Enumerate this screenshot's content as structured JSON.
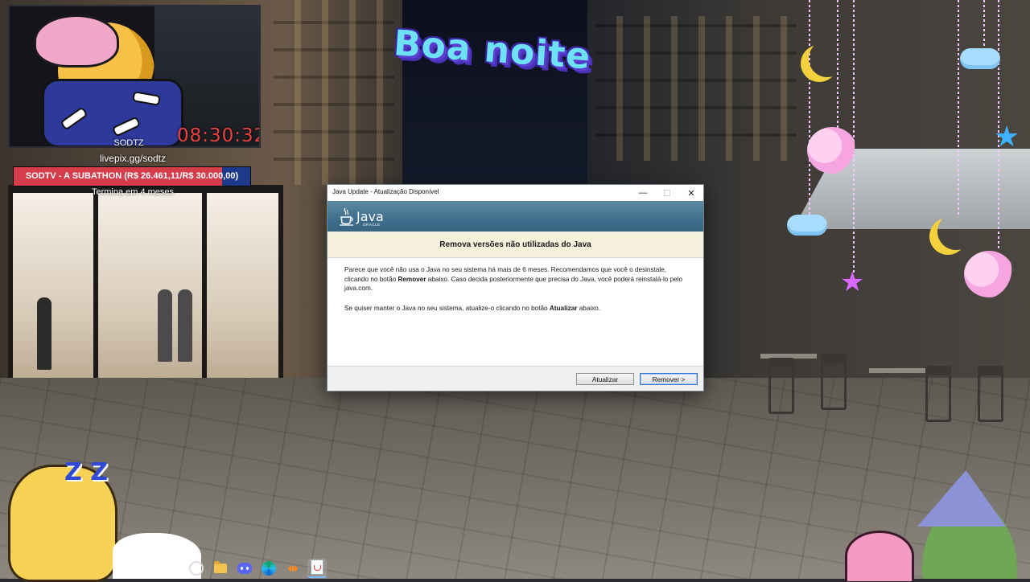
{
  "overlay": {
    "timer": "08:30:32",
    "handle": "SODTZ",
    "livepix": "livepix.gg/sodtz",
    "subathon": {
      "text": "SODTV - A SUBATHON (R$ 26.461,11/R$ 30.000,00)",
      "progress": 0.882
    },
    "subathon_remaining": "Termina em 4 meses",
    "greeting": "Boa noite",
    "zz_text": "Z Z"
  },
  "dialog": {
    "title": "Java Update - Atualização Disponível",
    "logo_text": "Java",
    "logo_subtext": "ORACLE",
    "heading": "Remova versões não utilizadas do Java",
    "paragraph1_part1": "Parece que você não usa o Java no seu sistema há mais de 6 meses. Recomendamos que você o desinstale, clicando no botão ",
    "paragraph1_bold": "Remover",
    "paragraph1_part2": " abaixo. Caso decida posteriormente que precisa do Java, você poderá reinstalá-lo pelo java.com.",
    "paragraph2_part1": "Se quiser manter o Java no seu sistema, atualize-o clicando no botão ",
    "paragraph2_bold": "Atualizar",
    "paragraph2_part2": " abaixo.",
    "update_button": "Atualizar",
    "remove_button": "Remover >",
    "minimize_glyph": "—",
    "maximize_glyph": "☐",
    "close_glyph": "✕"
  },
  "taskbar": {
    "icons": [
      "search-icon",
      "file-explorer-icon",
      "discord-icon",
      "edge-icon",
      "app-icon",
      "java-icon"
    ],
    "other_glyph": "⇹"
  },
  "colors": {
    "timer": "#e8413f",
    "subathon_fill": "#d63d4b",
    "subathon_track": "#1d3b8a",
    "java_banner": "#3f6f8c",
    "greeting_text": "#6de2f4"
  }
}
